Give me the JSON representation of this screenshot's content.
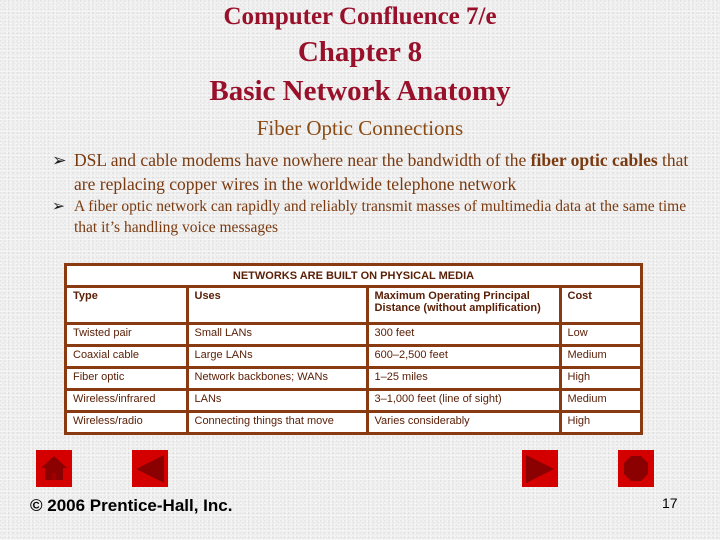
{
  "header": {
    "title_line1": "Computer Confluence 7/e",
    "title_line2": "Chapter 8",
    "title_line3": "Basic Network Anatomy",
    "subtitle": "Fiber Optic Connections"
  },
  "bullets": [
    {
      "marker": "Ø",
      "text_before": "DSL and cable modems have nowhere near the bandwidth of the ",
      "bold": "fiber optic cables",
      "text_after": " that are replacing copper wires in the worldwide telephone network"
    },
    {
      "marker": "Ø",
      "text": "A fiber optic network can rapidly and reliably transmit masses of multimedia data at the same time that it’s handling voice messages"
    }
  ],
  "table": {
    "caption": "NETWORKS ARE BUILT ON PHYSICAL MEDIA",
    "headers": [
      "Type",
      "Uses",
      "Maximum Operating Principal Distance (without amplification)",
      "Cost"
    ],
    "rows": [
      [
        "Twisted pair",
        "Small LANs",
        "300 feet",
        "Low"
      ],
      [
        "Coaxial cable",
        "Large LANs",
        "600–2,500 feet",
        "Medium"
      ],
      [
        "Fiber optic",
        "Network backbones; WANs",
        "1–25 miles",
        "High"
      ],
      [
        "Wireless/infrared",
        "LANs",
        "3–1,000 feet (line of sight)",
        "Medium"
      ],
      [
        "Wireless/radio",
        "Connecting things that move",
        "Varies considerably",
        "High"
      ]
    ]
  },
  "navigation": {
    "buttons": [
      {
        "name": "home",
        "icon": "home-icon"
      },
      {
        "name": "previous",
        "icon": "triangle-left-icon"
      },
      {
        "name": "next",
        "icon": "triangle-right-icon"
      },
      {
        "name": "end",
        "icon": "octagon-stop-icon"
      }
    ],
    "button_color": "#d40000",
    "icon_color": "#8b0000"
  },
  "footer": {
    "copyright": "© 2006 Prentice-Hall, Inc.",
    "page_number": "17"
  }
}
